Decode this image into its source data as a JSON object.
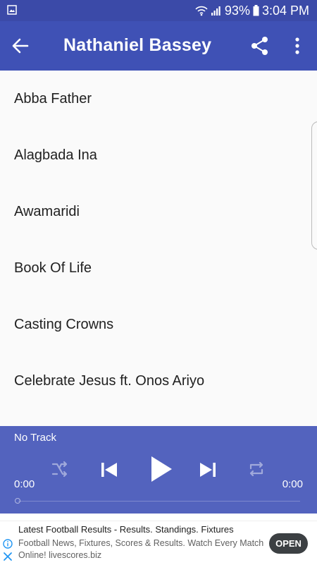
{
  "status_bar": {
    "battery": "93%",
    "time": "3:04 PM"
  },
  "app_bar": {
    "title": "Nathaniel Bassey",
    "back_icon": "back-arrow-icon",
    "share_icon": "share-icon",
    "more_icon": "more-vert-icon"
  },
  "songs": [
    "Abba Father",
    "Alagbada Ina",
    "Awamaridi",
    "Book Of Life",
    "Casting Crowns",
    "Celebrate Jesus ft. Onos Ariyo"
  ],
  "player": {
    "track": "No Track",
    "elapsed": "0:00",
    "duration": "0:00",
    "progress": 0,
    "controls": [
      "shuffle-icon",
      "previous-icon",
      "play-icon",
      "next-icon",
      "repeat-icon"
    ]
  },
  "ad": {
    "headline": "Latest Football Results - Results. Standings. Fixtures",
    "body": "Football News, Fixtures, Scores & Results. Watch Every Match Online! livescores.biz",
    "cta": "OPEN"
  },
  "colors": {
    "status_bar": "#3b4aa8",
    "app_bar": "#3f51b5",
    "player": "#5363be",
    "ad_button": "#3c4043",
    "ad_info": "#2196f3"
  }
}
